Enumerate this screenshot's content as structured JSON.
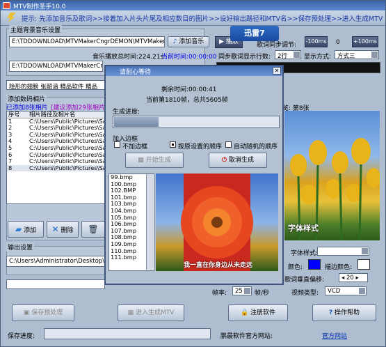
{
  "app": {
    "title": "MTV制作圣手10.0"
  },
  "steps": "提示: 先添加音乐及歌词>>接着加入片头片尾及相应数目的图片>>设好输出路径和MTV名>>保存预处理>>进入生成MTV",
  "music": {
    "group_label": "主题背景音乐设置",
    "path": "E:\\TDDOWNLOAD\\MTVMakerCngrDEMON\\MTVMakerCng",
    "add_button": "添加音乐",
    "total_time_label": "音乐播放总时间:224.21s",
    "current_time_label": "当前时间:00:00:00",
    "play_button": "播放",
    "sync_label": "歌词同步调节:",
    "minus_btn": "-100ms",
    "offset": "0",
    "plus_btn": "+100ms",
    "sync_rows_label": "同步歌词显示行数:",
    "sync_rows_value": "2行",
    "display_mode_label": "显示方式:",
    "display_mode_value": "方式三",
    "lyrics_path": "E:\\TDDOWNLOAD\\MTVMakerCngrDEMON\\MTVMakerCn"
  },
  "logo": {
    "text": "迅雷7"
  },
  "tags": "隐形的翅膀 张韶涵 精品软件 精品",
  "photos": {
    "group_label": "添加数码相片",
    "added_label": "已添加8张相片",
    "suggest_label": "[建议添加29张相片]",
    "col_index": "序号",
    "col_path": "相片路径及相片名",
    "rows": [
      {
        "n": "1",
        "path": "C:\\Users\\Public\\Pictures\\Sam"
      },
      {
        "n": "2",
        "path": "C:\\Users\\Public\\Pictures\\Sam"
      },
      {
        "n": "3",
        "path": "C:\\Users\\Public\\Pictures\\Sam"
      },
      {
        "n": "4",
        "path": "C:\\Users\\Public\\Pictures\\Sam"
      },
      {
        "n": "5",
        "path": "C:\\Users\\Public\\Pictures\\Sam"
      },
      {
        "n": "6",
        "path": "C:\\Users\\Public\\Pictures\\Sam"
      },
      {
        "n": "7",
        "path": "C:\\Users\\Public\\Pictures\\Sam"
      },
      {
        "n": "8",
        "path": "C:\\Users\\Public\\Pictures\\Sam"
      }
    ],
    "add_button": "添加",
    "delete_button": "删除"
  },
  "preview": {
    "label": "览: 第8张",
    "caption": "字体样式"
  },
  "output": {
    "group_label": "输出设置",
    "path": "C:\\Users\\Administrator\\Desktop\\"
  },
  "font": {
    "style_label": "字体样式:",
    "color_label": "颜色:",
    "stroke_label": "描边颜色:",
    "lyrics_offset_label": "歌词垂直偏移:",
    "lyrics_offset_value": "20",
    "fps_label": "帧率:",
    "fps_value": "25",
    "fps_unit": "帧/秒",
    "video_type_label": "视频类型:",
    "video_type_value": "VCD",
    "text_color": "#0000ff",
    "stroke_color": "#ffffff"
  },
  "bottom": {
    "save_button": "保存预处理",
    "generate_button": "进入生成MTV",
    "register_button": "注册软件",
    "help_button": "操作帮助",
    "progress_label": "保存进度:",
    "site_label": "鹏晨软件官方网站:",
    "site_link": "官方网站"
  },
  "dialog": {
    "title": "请耐心等待",
    "remaining": "剩余时间:00:00:41",
    "current_frame": "当前第1810帧，总共5605帧",
    "progress_label": "生成进度:",
    "progress": 0.27,
    "border_label": "加入边框",
    "no_border": "不加边框",
    "order_option": "按原设置的顺序",
    "random_option": "自动随机的顺序",
    "start_button": "开始生成",
    "cancel_button": "取消生成",
    "files": [
      "99.bmp",
      "100.bmp",
      "102.BMP",
      "101.bmp",
      "103.bmp",
      "104.bmp",
      "105.bmp",
      "106.bmp",
      "107.bmp",
      "108.bmp",
      "109.bmp",
      "110.bmp",
      "111.bmp"
    ],
    "preview_caption": "我一直在你身边从未走远"
  }
}
